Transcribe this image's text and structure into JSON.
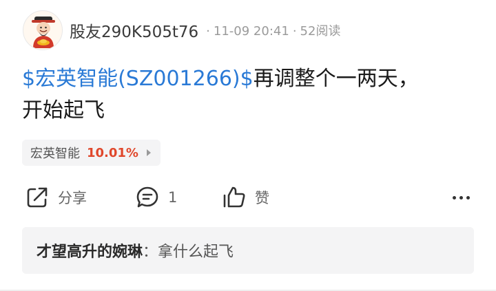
{
  "author": {
    "name": "股友290K505t76",
    "time": "11-09 20:41",
    "reads": "52阅读",
    "avatar_icon": "fortune-god-avatar"
  },
  "post": {
    "stock_link": "$宏英智能(SZ001266)$",
    "text_line1": "再调整个一两天，",
    "text_line2": "开始起飞"
  },
  "stock_tag": {
    "name": "宏英智能",
    "change": "10.01%",
    "change_color": "#e0472b"
  },
  "actions": {
    "share_label": "分享",
    "comment_count": "1",
    "like_label": "赞",
    "share_icon": "share-icon",
    "comment_icon": "comment-icon",
    "like_icon": "thumbs-up-icon",
    "more_icon": "more-icon"
  },
  "comment": {
    "author": "才望高升的婉琳",
    "separator": "：",
    "text": "拿什么起飞"
  },
  "colors": {
    "link": "#2a7ad6",
    "gain": "#e0472b",
    "muted": "#9a9a9a"
  }
}
